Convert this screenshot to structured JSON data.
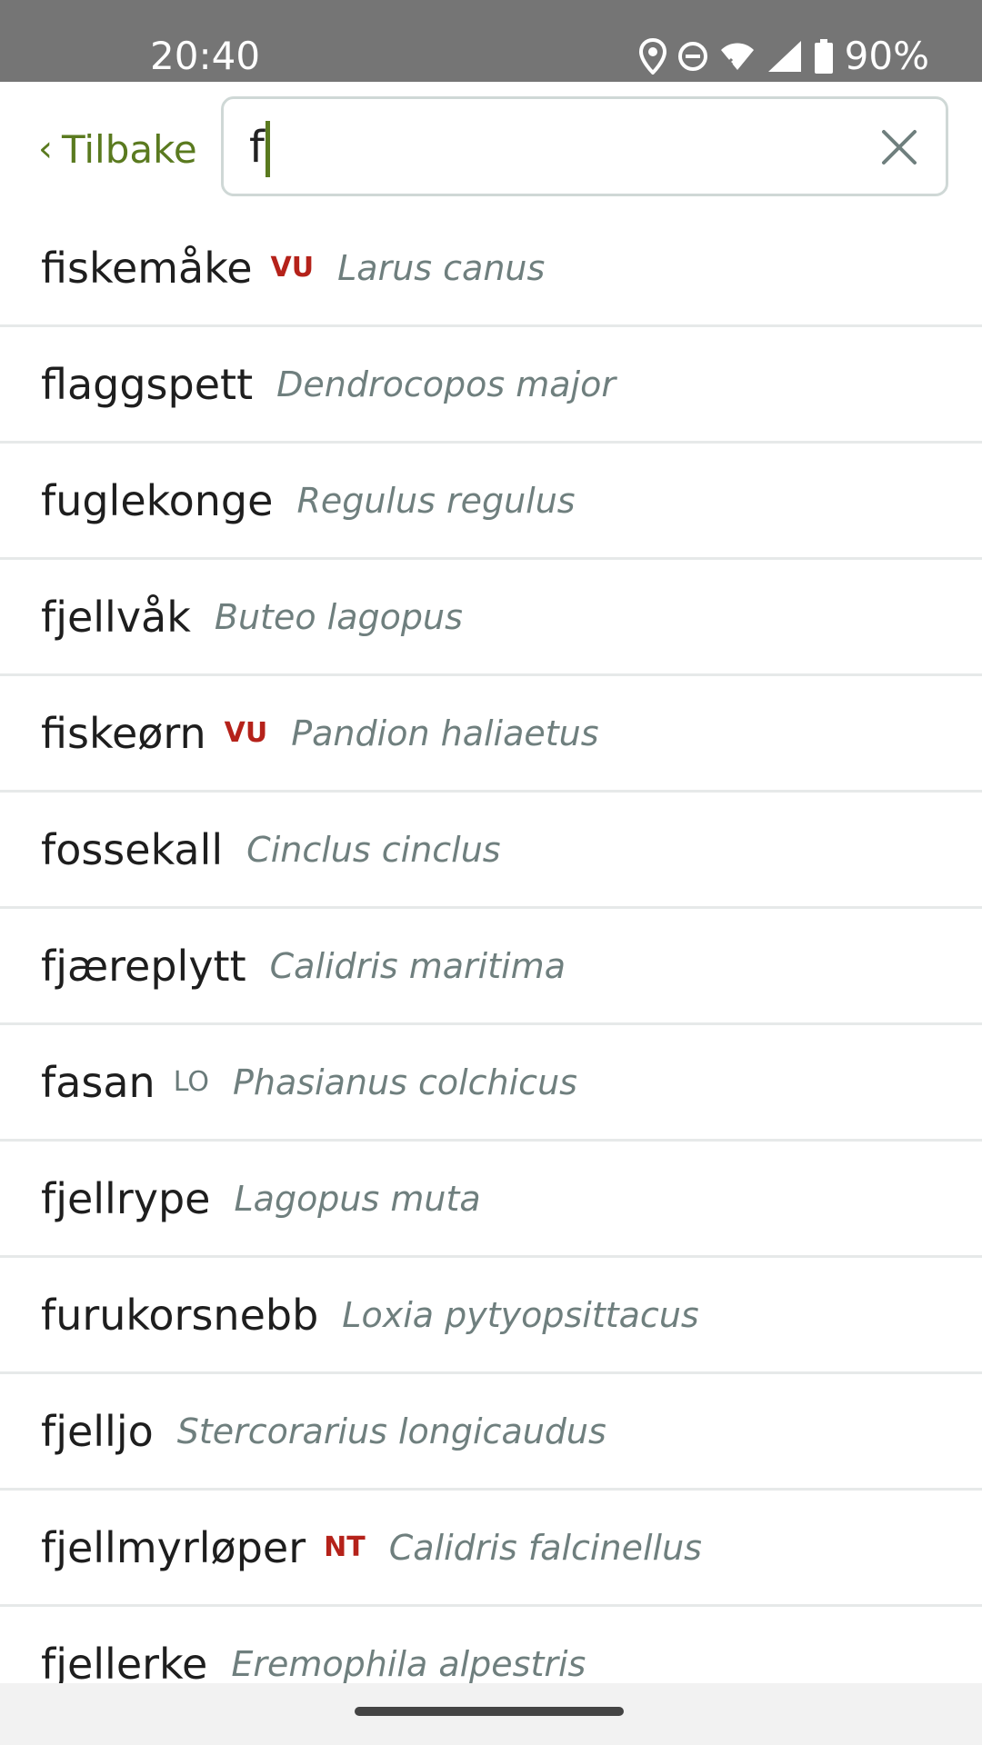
{
  "status_bar": {
    "time": "20:40",
    "battery_text": "90%",
    "icons": [
      "location-icon",
      "do-not-disturb-icon",
      "wifi-icon",
      "cell-signal-icon",
      "battery-icon"
    ]
  },
  "header": {
    "back_label": "Tilbake",
    "back_chevron": "‹",
    "search_value": "f",
    "accent_color": "#5a7a1f"
  },
  "results": [
    {
      "common": "fiskemåke",
      "status": "VU",
      "latin": "Larus canus"
    },
    {
      "common": "flaggspett",
      "status": "",
      "latin": "Dendrocopos major"
    },
    {
      "common": "fuglekonge",
      "status": "",
      "latin": "Regulus regulus"
    },
    {
      "common": "fjellvåk",
      "status": "",
      "latin": "Buteo lagopus"
    },
    {
      "common": "fiskeørn",
      "status": "VU",
      "latin": "Pandion haliaetus"
    },
    {
      "common": "fossekall",
      "status": "",
      "latin": "Cinclus cinclus"
    },
    {
      "common": "fjæreplytt",
      "status": "",
      "latin": "Calidris maritima"
    },
    {
      "common": "fasan",
      "status": "LO",
      "latin": "Phasianus colchicus"
    },
    {
      "common": "fjellrype",
      "status": "",
      "latin": "Lagopus muta"
    },
    {
      "common": "furukorsnebb",
      "status": "",
      "latin": "Loxia pytyopsittacus"
    },
    {
      "common": "fjelljo",
      "status": "",
      "latin": "Stercorarius longicaudus"
    },
    {
      "common": "fjellmyrløper",
      "status": "NT",
      "latin": "Calidris falcinellus"
    },
    {
      "common": "fjellerke",
      "status": "",
      "latin": "Eremophila alpestris"
    }
  ]
}
